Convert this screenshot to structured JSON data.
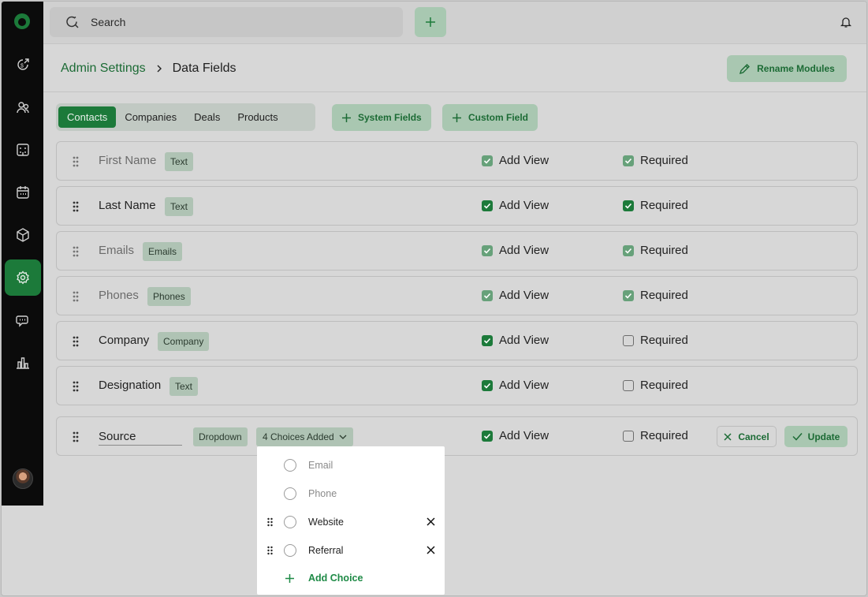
{
  "search": {
    "placeholder": "Search"
  },
  "breadcrumb": {
    "parent": "Admin Settings",
    "current": "Data Fields"
  },
  "header": {
    "rename_label": "Rename Modules"
  },
  "tabs": [
    {
      "label": "Contacts",
      "active": true
    },
    {
      "label": "Companies",
      "active": false
    },
    {
      "label": "Deals",
      "active": false
    },
    {
      "label": "Products",
      "active": false
    }
  ],
  "actions": {
    "system_fields": "System Fields",
    "custom_field": "Custom Field"
  },
  "fields": [
    {
      "name": "First Name",
      "type": "Text",
      "add_view": "Add View",
      "add_view_checked": true,
      "required": "Required",
      "required_checked": true,
      "locked": true
    },
    {
      "name": "Last Name",
      "type": "Text",
      "add_view": "Add View",
      "add_view_checked": true,
      "required": "Required",
      "required_checked": true,
      "locked": false
    },
    {
      "name": "Emails",
      "type": "Emails",
      "add_view": "Add View",
      "add_view_checked": true,
      "required": "Required",
      "required_checked": true,
      "locked": true
    },
    {
      "name": "Phones",
      "type": "Phones",
      "add_view": "Add View",
      "add_view_checked": true,
      "required": "Required",
      "required_checked": true,
      "locked": true
    },
    {
      "name": "Company",
      "type": "Company",
      "add_view": "Add View",
      "add_view_checked": true,
      "required": "Required",
      "required_checked": false,
      "locked": false
    },
    {
      "name": "Designation",
      "type": "Text",
      "add_view": "Add View",
      "add_view_checked": true,
      "required": "Required",
      "required_checked": false,
      "locked": false
    }
  ],
  "editing": {
    "name": "Source",
    "type": "Dropdown",
    "choices_label": "4 Choices Added",
    "add_view": "Add View",
    "required": "Required",
    "cancel": "Cancel",
    "update": "Update"
  },
  "choices": [
    {
      "label": "Email",
      "default": true
    },
    {
      "label": "Phone",
      "default": true
    },
    {
      "label": "Website",
      "default": false
    },
    {
      "label": "Referral",
      "default": false
    }
  ],
  "add_choice": "Add Choice",
  "colors": {
    "accent": "#1c7a3a",
    "accent_light": "#a9c7b1",
    "sidebar": "#0b0b0b"
  },
  "icons": {
    "sidebar": [
      "logo-icon",
      "deals-icon",
      "contacts-icon",
      "companies-icon",
      "calendar-icon",
      "products-icon",
      "settings-icon",
      "chat-icon",
      "reports-icon"
    ]
  }
}
